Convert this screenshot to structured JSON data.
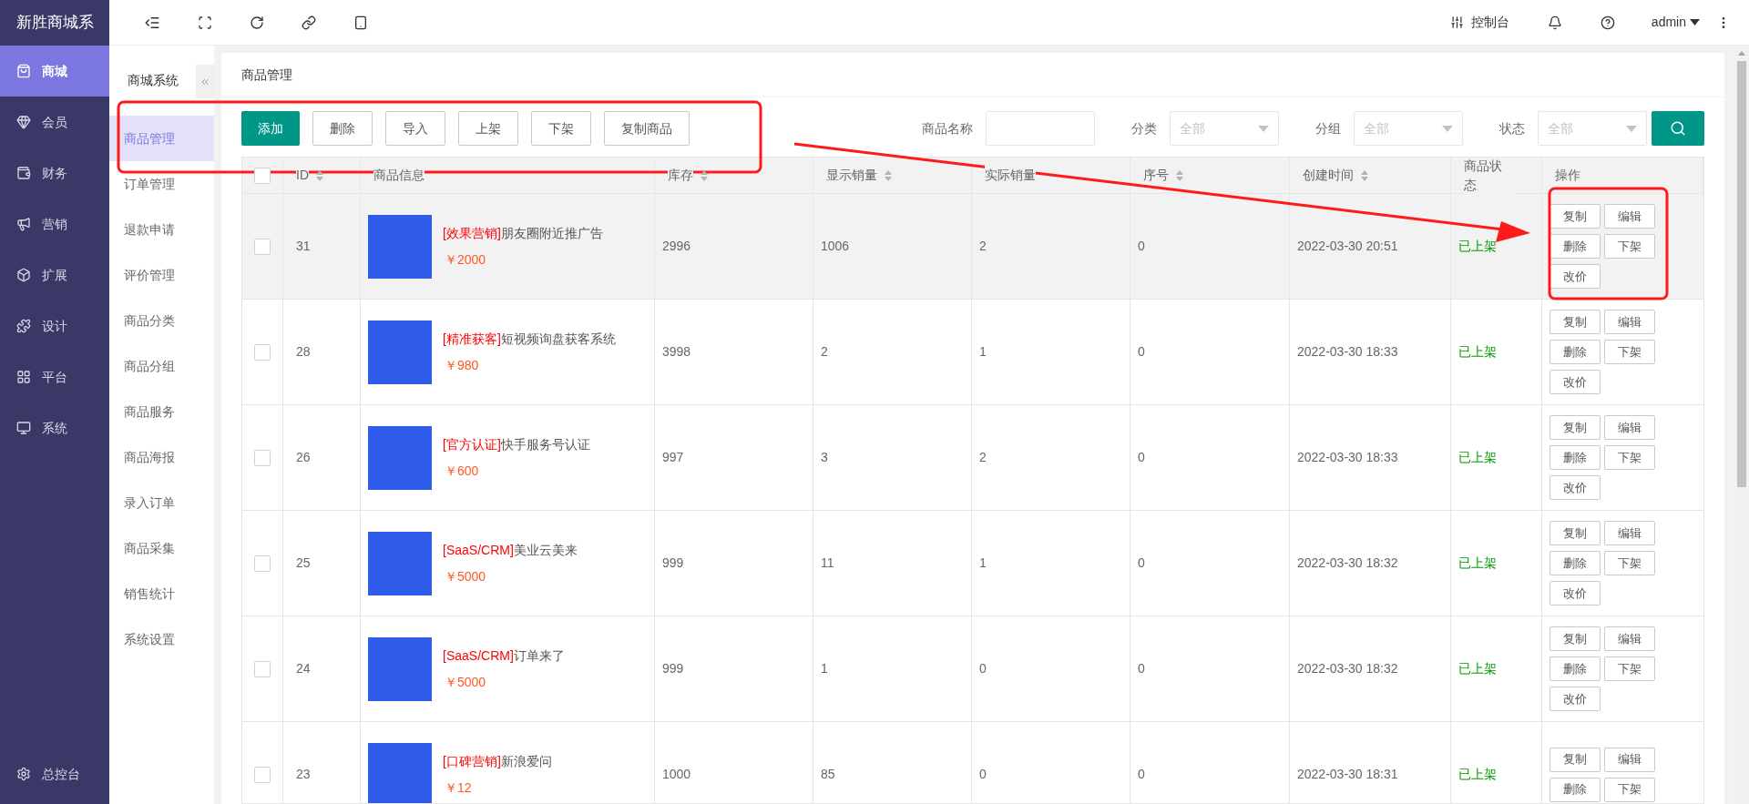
{
  "brand": "新胜商城系",
  "sidebar": {
    "items": [
      {
        "label": "商城",
        "selected": true
      },
      {
        "label": "会员",
        "selected": false
      },
      {
        "label": "财务",
        "selected": false
      },
      {
        "label": "营销",
        "selected": false
      },
      {
        "label": "扩展",
        "selected": false
      },
      {
        "label": "设计",
        "selected": false
      },
      {
        "label": "平台",
        "selected": false
      },
      {
        "label": "系统",
        "selected": false
      }
    ],
    "footer": {
      "label": "总控台"
    }
  },
  "topbar": {
    "console": "控制台",
    "user": "admin"
  },
  "subnav": {
    "title": "商城系统",
    "items": [
      {
        "label": "商品管理",
        "selected": true
      },
      {
        "label": "订单管理",
        "selected": false
      },
      {
        "label": "退款申请",
        "selected": false
      },
      {
        "label": "评价管理",
        "selected": false
      },
      {
        "label": "商品分类",
        "selected": false
      },
      {
        "label": "商品分组",
        "selected": false
      },
      {
        "label": "商品服务",
        "selected": false
      },
      {
        "label": "商品海报",
        "selected": false
      },
      {
        "label": "录入订单",
        "selected": false
      },
      {
        "label": "商品采集",
        "selected": false
      },
      {
        "label": "销售统计",
        "selected": false
      },
      {
        "label": "系统设置",
        "selected": false
      }
    ]
  },
  "page": {
    "title": "商品管理"
  },
  "toolbar": {
    "buttons": [
      {
        "label": "添加",
        "kind": "primary"
      },
      {
        "label": "删除",
        "kind": "default"
      },
      {
        "label": "导入",
        "kind": "default"
      },
      {
        "label": "上架",
        "kind": "default"
      },
      {
        "label": "下架",
        "kind": "default"
      },
      {
        "label": "复制商品",
        "kind": "default"
      }
    ]
  },
  "filters": {
    "name": {
      "label": "商品名称"
    },
    "selects": [
      {
        "label": "分类",
        "placeholder": "全部"
      },
      {
        "label": "分组",
        "placeholder": "全部"
      },
      {
        "label": "状态",
        "placeholder": "全部"
      }
    ]
  },
  "table": {
    "select_all": {
      "checked": false
    },
    "columns": [
      {
        "label": "ID",
        "sortable": true
      },
      {
        "label": "商品信息",
        "sortable": false
      },
      {
        "label": "库存",
        "sortable": true
      },
      {
        "label": "显示销量",
        "sortable": true
      },
      {
        "label": "实际销量",
        "sortable": false
      },
      {
        "label": "序号",
        "sortable": true
      },
      {
        "label": "创建时间",
        "sortable": true
      },
      {
        "label": "商品状态",
        "sortable": false
      },
      {
        "label": "操作",
        "sortable": false
      }
    ],
    "rows": [
      {
        "id": "31",
        "tag": "[效果营销]",
        "title": "朋友圈附近推广告",
        "price": "￥2000",
        "stock": "2996",
        "shown_sales": "1006",
        "actual_sales": "2",
        "order": "0",
        "created": "2022-03-30 20:51",
        "status": "已上架",
        "checked": false,
        "hovered": true,
        "actions": [
          "复制",
          "编辑",
          "删除",
          "下架",
          "改价"
        ]
      },
      {
        "id": "28",
        "tag": "[精准获客]",
        "title": "短视频询盘获客系统",
        "price": "￥980",
        "stock": "3998",
        "shown_sales": "2",
        "actual_sales": "1",
        "order": "0",
        "created": "2022-03-30 18:33",
        "status": "已上架",
        "checked": false,
        "hovered": false,
        "actions": [
          "复制",
          "编辑",
          "删除",
          "下架",
          "改价"
        ]
      },
      {
        "id": "26",
        "tag": "[官方认证]",
        "title": "快手服务号认证",
        "price": "￥600",
        "stock": "997",
        "shown_sales": "3",
        "actual_sales": "2",
        "order": "0",
        "created": "2022-03-30 18:33",
        "status": "已上架",
        "checked": false,
        "hovered": false,
        "actions": [
          "复制",
          "编辑",
          "删除",
          "下架",
          "改价"
        ]
      },
      {
        "id": "25",
        "tag": "[SaaS/CRM]",
        "title": "美业云美来",
        "price": "￥5000",
        "stock": "999",
        "shown_sales": "11",
        "actual_sales": "1",
        "order": "0",
        "created": "2022-03-30 18:32",
        "status": "已上架",
        "checked": false,
        "hovered": false,
        "actions": [
          "复制",
          "编辑",
          "删除",
          "下架",
          "改价"
        ]
      },
      {
        "id": "24",
        "tag": "[SaaS/CRM]",
        "title": "订单来了",
        "price": "￥5000",
        "stock": "999",
        "shown_sales": "1",
        "actual_sales": "0",
        "order": "0",
        "created": "2022-03-30 18:32",
        "status": "已上架",
        "checked": false,
        "hovered": false,
        "actions": [
          "复制",
          "编辑",
          "删除",
          "下架",
          "改价"
        ]
      },
      {
        "id": "23",
        "tag": "[口碑营销]",
        "title": "新浪爱问",
        "price": "￥12",
        "stock": "1000",
        "shown_sales": "85",
        "actual_sales": "0",
        "order": "0",
        "created": "2022-03-30 18:31",
        "status": "已上架",
        "checked": false,
        "hovered": false,
        "actions": [
          "复制",
          "编辑",
          "删除",
          "下架"
        ]
      }
    ]
  }
}
